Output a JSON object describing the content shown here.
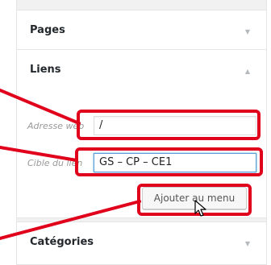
{
  "sections": {
    "pages": {
      "title": "Pages"
    },
    "liens": {
      "title": "Liens",
      "url_label": "Adresse web",
      "url_value": "/",
      "text_label": "Cible du lien",
      "text_value": "GS – CP – CE1",
      "add_button": "Ajouter au menu"
    },
    "categories": {
      "title": "Catégories"
    }
  },
  "icons": {
    "collapsed_chevron": "chevron-down-icon",
    "expanded_chevron": "chevron-up-icon",
    "pointer": "mouse-cursor-icon"
  },
  "colors": {
    "highlight": "#e0001b",
    "focus_border": "#5b9dd9"
  }
}
